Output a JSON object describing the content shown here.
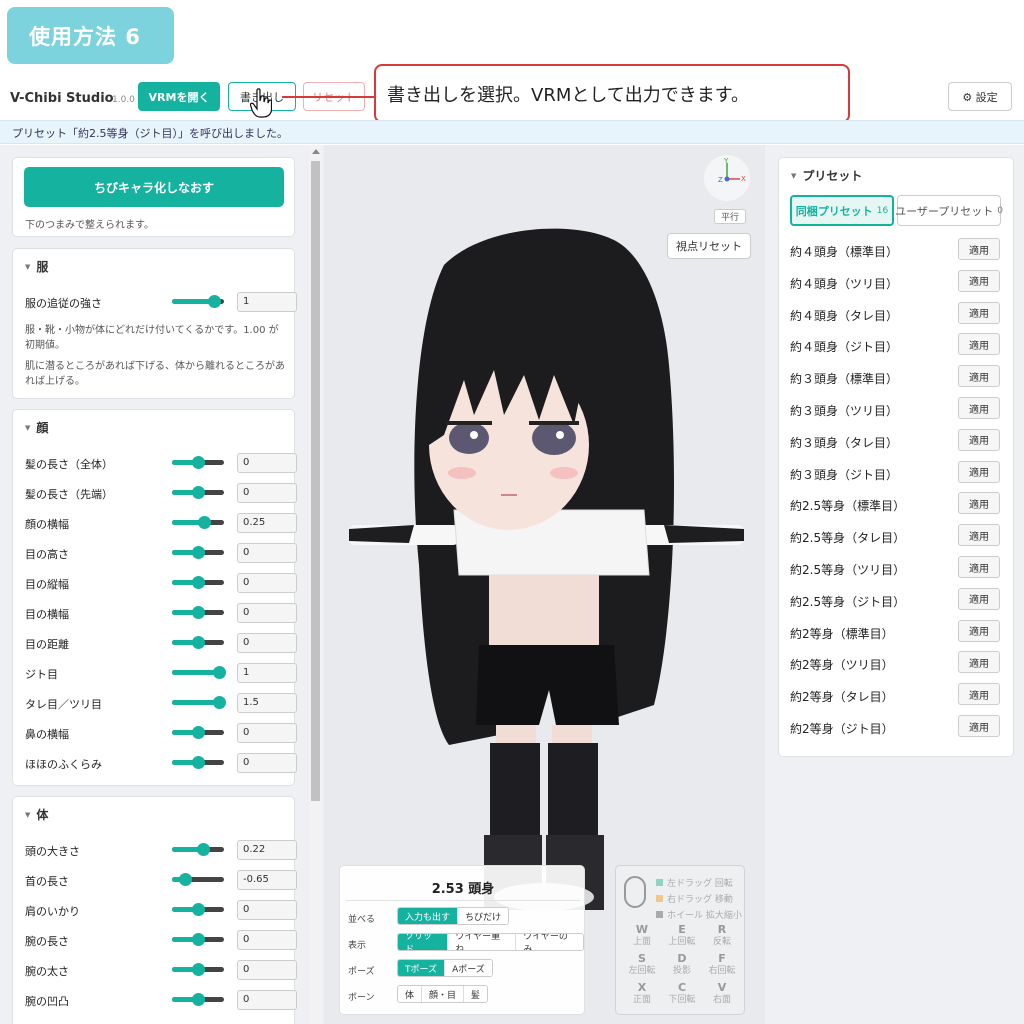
{
  "tutorial_badge": "使用方法 6",
  "header": {
    "title": "V-Chibi Studio",
    "version": "1.0.0",
    "open_vrm": "VRMを開く",
    "export": "書き出し",
    "reset": "リセット",
    "settings": "⚙ 設定"
  },
  "callout": "書き出しを選択。VRMとして出力できます。",
  "status": "プリセット「約2.5等身（ジト目）」を呼び出しました。",
  "left": {
    "rechibi_button": "ちびキャラ化しなおす",
    "rechibi_hint": "下のつまみで整えられます。",
    "clothes": {
      "title": "服",
      "rows": [
        {
          "label": "服の追従の強さ",
          "value": "1",
          "level": 0.8
        }
      ],
      "desc1": "服・靴・小物が体にどれだけ付いてくるかです。1.00 が初期値。",
      "desc2": "肌に潜るところがあれば下げる、体から離れるところがあれば上げる。"
    },
    "face": {
      "title": "顔",
      "rows": [
        {
          "label": "髪の長さ（全体）",
          "value": "0",
          "level": 0.5
        },
        {
          "label": "髪の長さ（先端）",
          "value": "0",
          "level": 0.5
        },
        {
          "label": "顔の横幅",
          "value": "0.25",
          "level": 0.62
        },
        {
          "label": "目の高さ",
          "value": "0",
          "level": 0.5
        },
        {
          "label": "目の縦幅",
          "value": "0",
          "level": 0.5
        },
        {
          "label": "目の横幅",
          "value": "0",
          "level": 0.5
        },
        {
          "label": "目の距離",
          "value": "0",
          "level": 0.5
        },
        {
          "label": "ジト目",
          "value": "1",
          "level": 0.9
        },
        {
          "label": "タレ目／ツリ目",
          "value": "1.5",
          "level": 0.9
        },
        {
          "label": "鼻の横幅",
          "value": "0",
          "level": 0.5
        },
        {
          "label": "ほほのふくらみ",
          "value": "0",
          "level": 0.5
        }
      ]
    },
    "body": {
      "title": "体",
      "rows": [
        {
          "label": "頭の大きさ",
          "value": "0.22",
          "level": 0.6
        },
        {
          "label": "首の長さ",
          "value": "-0.65",
          "level": 0.25
        },
        {
          "label": "肩のいかり",
          "value": "0",
          "level": 0.5
        },
        {
          "label": "腕の長さ",
          "value": "0",
          "level": 0.5
        },
        {
          "label": "腕の太さ",
          "value": "0",
          "level": 0.5
        },
        {
          "label": "腕の凹凸",
          "value": "0",
          "level": 0.5
        }
      ]
    }
  },
  "viewport": {
    "ortho": "平行",
    "view_reset": "視点リセット",
    "head_count": "2.53 頭身",
    "arrange_label": "並べる",
    "arrange": [
      "入力も出す",
      "ちびだけ"
    ],
    "display_label": "表示",
    "display": [
      "ソリッド",
      "ワイヤー重ね",
      "ワイヤーのみ"
    ],
    "pose_label": "ポーズ",
    "pose": [
      "Tポーズ",
      "Aポーズ"
    ],
    "bone_label": "ボーン",
    "bone": [
      "体",
      "顔・目",
      "髪"
    ],
    "mouse_help": [
      {
        "text": "左ドラッグ 回転",
        "color": "#8fd3c3"
      },
      {
        "text": "右ドラッグ 移動",
        "color": "#f0c98a"
      },
      {
        "text": "ホイール 拡大縮小",
        "color": "#aaaaaa"
      }
    ],
    "keys": [
      {
        "key": "W",
        "label": "上面"
      },
      {
        "key": "E",
        "label": "上回転"
      },
      {
        "key": "R",
        "label": "反転"
      },
      {
        "key": "S",
        "label": "左回転"
      },
      {
        "key": "D",
        "label": "投影"
      },
      {
        "key": "F",
        "label": "右回転"
      },
      {
        "key": "X",
        "label": "正面"
      },
      {
        "key": "C",
        "label": "下回転"
      },
      {
        "key": "V",
        "label": "右面"
      }
    ]
  },
  "presets": {
    "title": "プリセット",
    "tab_bundled": "同梱プリセット",
    "tab_bundled_count": "16",
    "tab_user": "ユーザープリセット",
    "tab_user_count": "0",
    "apply_label": "適用",
    "items": [
      "約４頭身（標準目）",
      "約４頭身（ツリ目）",
      "約４頭身（タレ目）",
      "約４頭身（ジト目）",
      "約３頭身（標準目）",
      "約３頭身（ツリ目）",
      "約３頭身（タレ目）",
      "約３頭身（ジト目）",
      "約2.5等身（標準目）",
      "約2.5等身（タレ目）",
      "約2.5等身（ツリ目）",
      "約2.5等身（ジト目）",
      "約2等身（標準目）",
      "約2等身（ツリ目）",
      "約2等身（タレ目）",
      "約2等身（ジト目）"
    ]
  }
}
